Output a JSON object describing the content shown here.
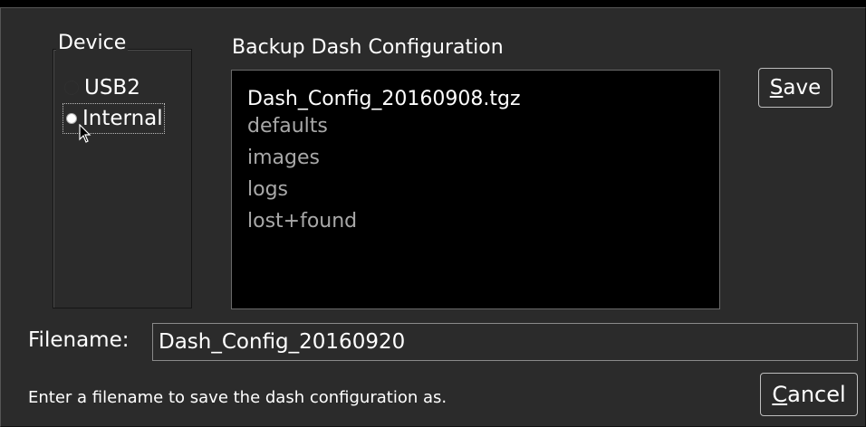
{
  "device": {
    "legend": "Device",
    "options": [
      {
        "label": "USB2",
        "selected": false
      },
      {
        "label": "Internal",
        "selected": true
      }
    ]
  },
  "backup": {
    "title": "Backup Dash Configuration",
    "files": [
      {
        "name": "Dash_Config_20160908.tgz",
        "type": "file"
      },
      {
        "name": "defaults",
        "type": "folder"
      },
      {
        "name": "images",
        "type": "folder"
      },
      {
        "name": "logs",
        "type": "folder"
      },
      {
        "name": "lost+found",
        "type": "folder"
      }
    ]
  },
  "buttons": {
    "save_first": "S",
    "save_rest": "ave",
    "cancel_first": "C",
    "cancel_rest": "ancel"
  },
  "filename": {
    "label": "Filename:",
    "value": "Dash_Config_20160920"
  },
  "hint": "Enter a filename to save the dash configuration as.",
  "colors": {
    "background": "#2b2b2b",
    "list_background": "#000000",
    "dim_text": "#a8a8a8"
  }
}
